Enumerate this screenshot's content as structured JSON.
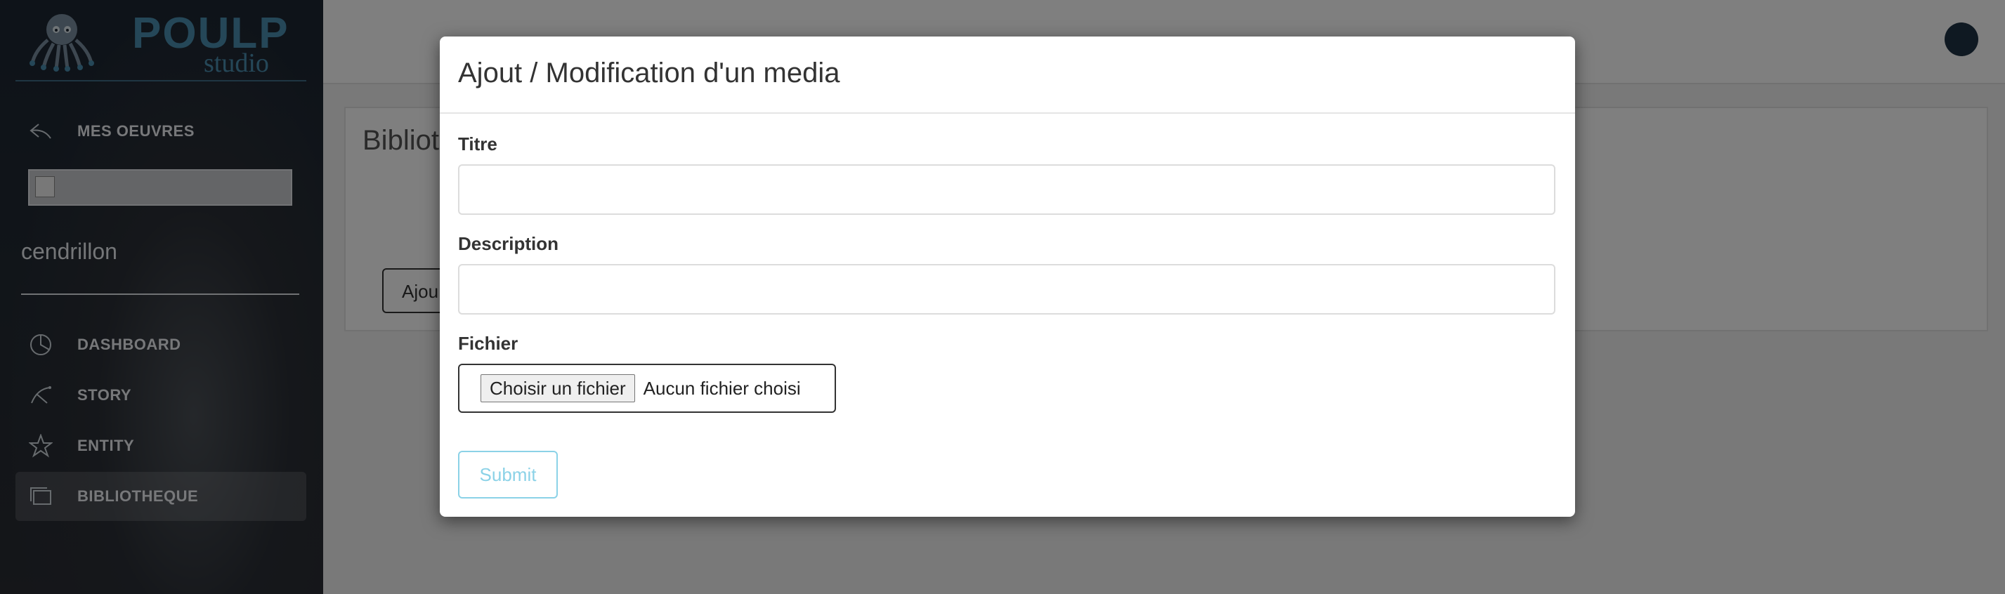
{
  "brand": {
    "title": "POULP",
    "subtitle": "studio",
    "color": "#4a8fb0"
  },
  "sidebar": {
    "back": {
      "label": "MES OEUVRES",
      "icon": "reply-arrow-icon"
    },
    "project_name": "cendrillon",
    "items": [
      {
        "label": "DASHBOARD",
        "icon": "pie-chart-icon",
        "active": false
      },
      {
        "label": "STORY",
        "icon": "branch-icon",
        "active": false
      },
      {
        "label": "ENTITY",
        "icon": "star-icon",
        "active": false
      },
      {
        "label": "BIBLIOTHEQUE",
        "icon": "gallery-icon",
        "active": true
      }
    ]
  },
  "background_page": {
    "title": "Biblioth",
    "add_button": "Ajou"
  },
  "modal": {
    "title": "Ajout / Modification d'un media",
    "fields": {
      "titre_label": "Titre",
      "titre_value": "",
      "description_label": "Description",
      "description_value": "",
      "fichier_label": "Fichier",
      "file_button": "Choisir un fichier",
      "file_status": "Aucun fichier choisi"
    },
    "submit_label": "Submit"
  },
  "colors": {
    "accent": "#5bc0de",
    "sidebar_bg": "#1c2633",
    "overlay": "rgba(0,0,0,0.5)"
  }
}
